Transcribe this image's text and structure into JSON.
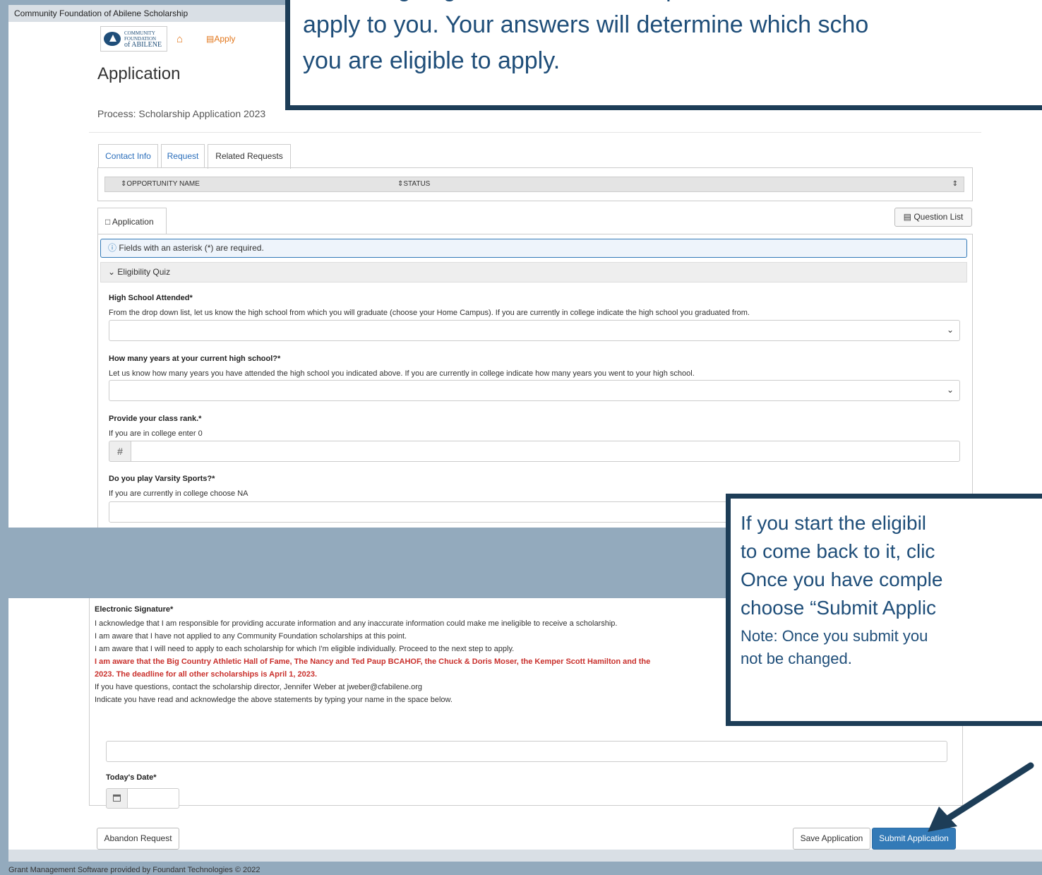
{
  "header": {
    "org_title": "Community Foundation of Abilene Scholarship",
    "logo_line1": "COMMUNITY",
    "logo_line2": "FOUNDATION",
    "logo_line3": "of ABILENE",
    "apply_link": "Apply"
  },
  "page": {
    "title": "Application",
    "process": "Process: Scholarship Application 2023"
  },
  "tabs": [
    "Contact Info",
    "Request",
    "Related Requests"
  ],
  "related_table": {
    "columns": [
      "OPPORTUNITY NAME",
      "STATUS"
    ]
  },
  "application": {
    "tab_label": "Application",
    "question_list_label": "Question List",
    "required_note": "Fields with an asterisk (*) are required.",
    "section_title": "Eligibility Quiz"
  },
  "questions": [
    {
      "label": "High School Attended*",
      "help": "From the drop down list, let us know the high school from which you will graduate (choose your Home Campus).   If you are currently in college indicate the high school you graduated from."
    },
    {
      "label": "How many years at your current high school?*",
      "help": "Let us know how many years you have attended the high school you indicated above.  If you are currently in college indicate how many years you went to your high school."
    },
    {
      "label": "Provide your class rank.*",
      "help": "If you are in college enter 0",
      "addon": "#"
    },
    {
      "label": "Do you play Varsity Sports?*",
      "help": "If you are currently in college choose NA"
    }
  ],
  "callout_top": {
    "line1": "...ou are going to be asked a few questions to deter...",
    "line2": "apply to you. Your answers will determine which scho",
    "line3": "you are eligible to apply."
  },
  "callout_mid": {
    "line1": "If you start the eligibil",
    "line2": "to come back to it, clic",
    "line3": "Once you have comple",
    "line4": "choose “Submit Applic",
    "note1": "Note:  Once you submit you",
    "note2": "not be changed."
  },
  "signature": {
    "label": "Electronic Signature*",
    "lines": [
      "I acknowledge that I am responsible for providing accurate information and any inaccurate information could make me ineligible to receive a scholarship.",
      "I am aware that I have not applied to any Community Foundation scholarships at this point.",
      "I am aware that I will need to apply to each scholarship for which I'm eligible individually.  Proceed to the next step to apply."
    ],
    "red_line1": "I am aware that the Big Country Athletic Hall of Fame, The Nancy and Ted Paup BCAHOF, the Chuck & Doris Moser, the Kemper Scott Hamilton and the",
    "red_line2": "2023.  The deadline for all other scholarships is April 1, 2023.",
    "contact_line": "If you have questions, contact the scholarship director, Jennifer Weber at jweber@cfabilene.org",
    "instruction_line": "Indicate you have read and acknowledge the above statements by typing your name in the space below."
  },
  "date_field": {
    "label": "Today's Date*"
  },
  "buttons": {
    "abandon": "Abandon Request",
    "save": "Save Application",
    "submit": "Submit Application"
  },
  "footer": {
    "text": "Grant Management Software provided by Foundant Technologies © 2022"
  },
  "colors": {
    "background": "#93aabd",
    "callout_border": "#1d3d57",
    "callout_text": "#1f4e79",
    "accent_orange": "#e2761b",
    "primary_button": "#337ab7",
    "warning_red": "#c9302c"
  }
}
